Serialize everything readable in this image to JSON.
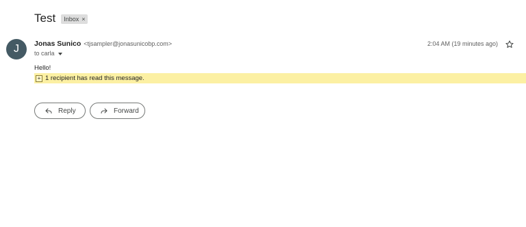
{
  "message": {
    "subject": "Test",
    "label_chip": "Inbox",
    "label_remove": "×",
    "sender": {
      "avatar_letter": "J",
      "name": "Jonas Sunico",
      "email": "<tjsampler@jonasunicobp.com>"
    },
    "recipient_line": "to carla",
    "timestamp": "2:04 AM (19 minutes ago)",
    "body": "Hello!",
    "read_receipt": {
      "expand_symbol": "+",
      "text": "1 recipient has read this message."
    }
  },
  "actions": {
    "reply_label": "Reply",
    "forward_label": "Forward"
  },
  "icons": {
    "star": "star-outline-icon",
    "reply": "reply-arrow-icon",
    "forward": "forward-arrow-icon",
    "dropdown": "caret-down-icon"
  },
  "colors": {
    "avatar_bg": "#445a64",
    "banner_bg": "#fcf0a3"
  }
}
